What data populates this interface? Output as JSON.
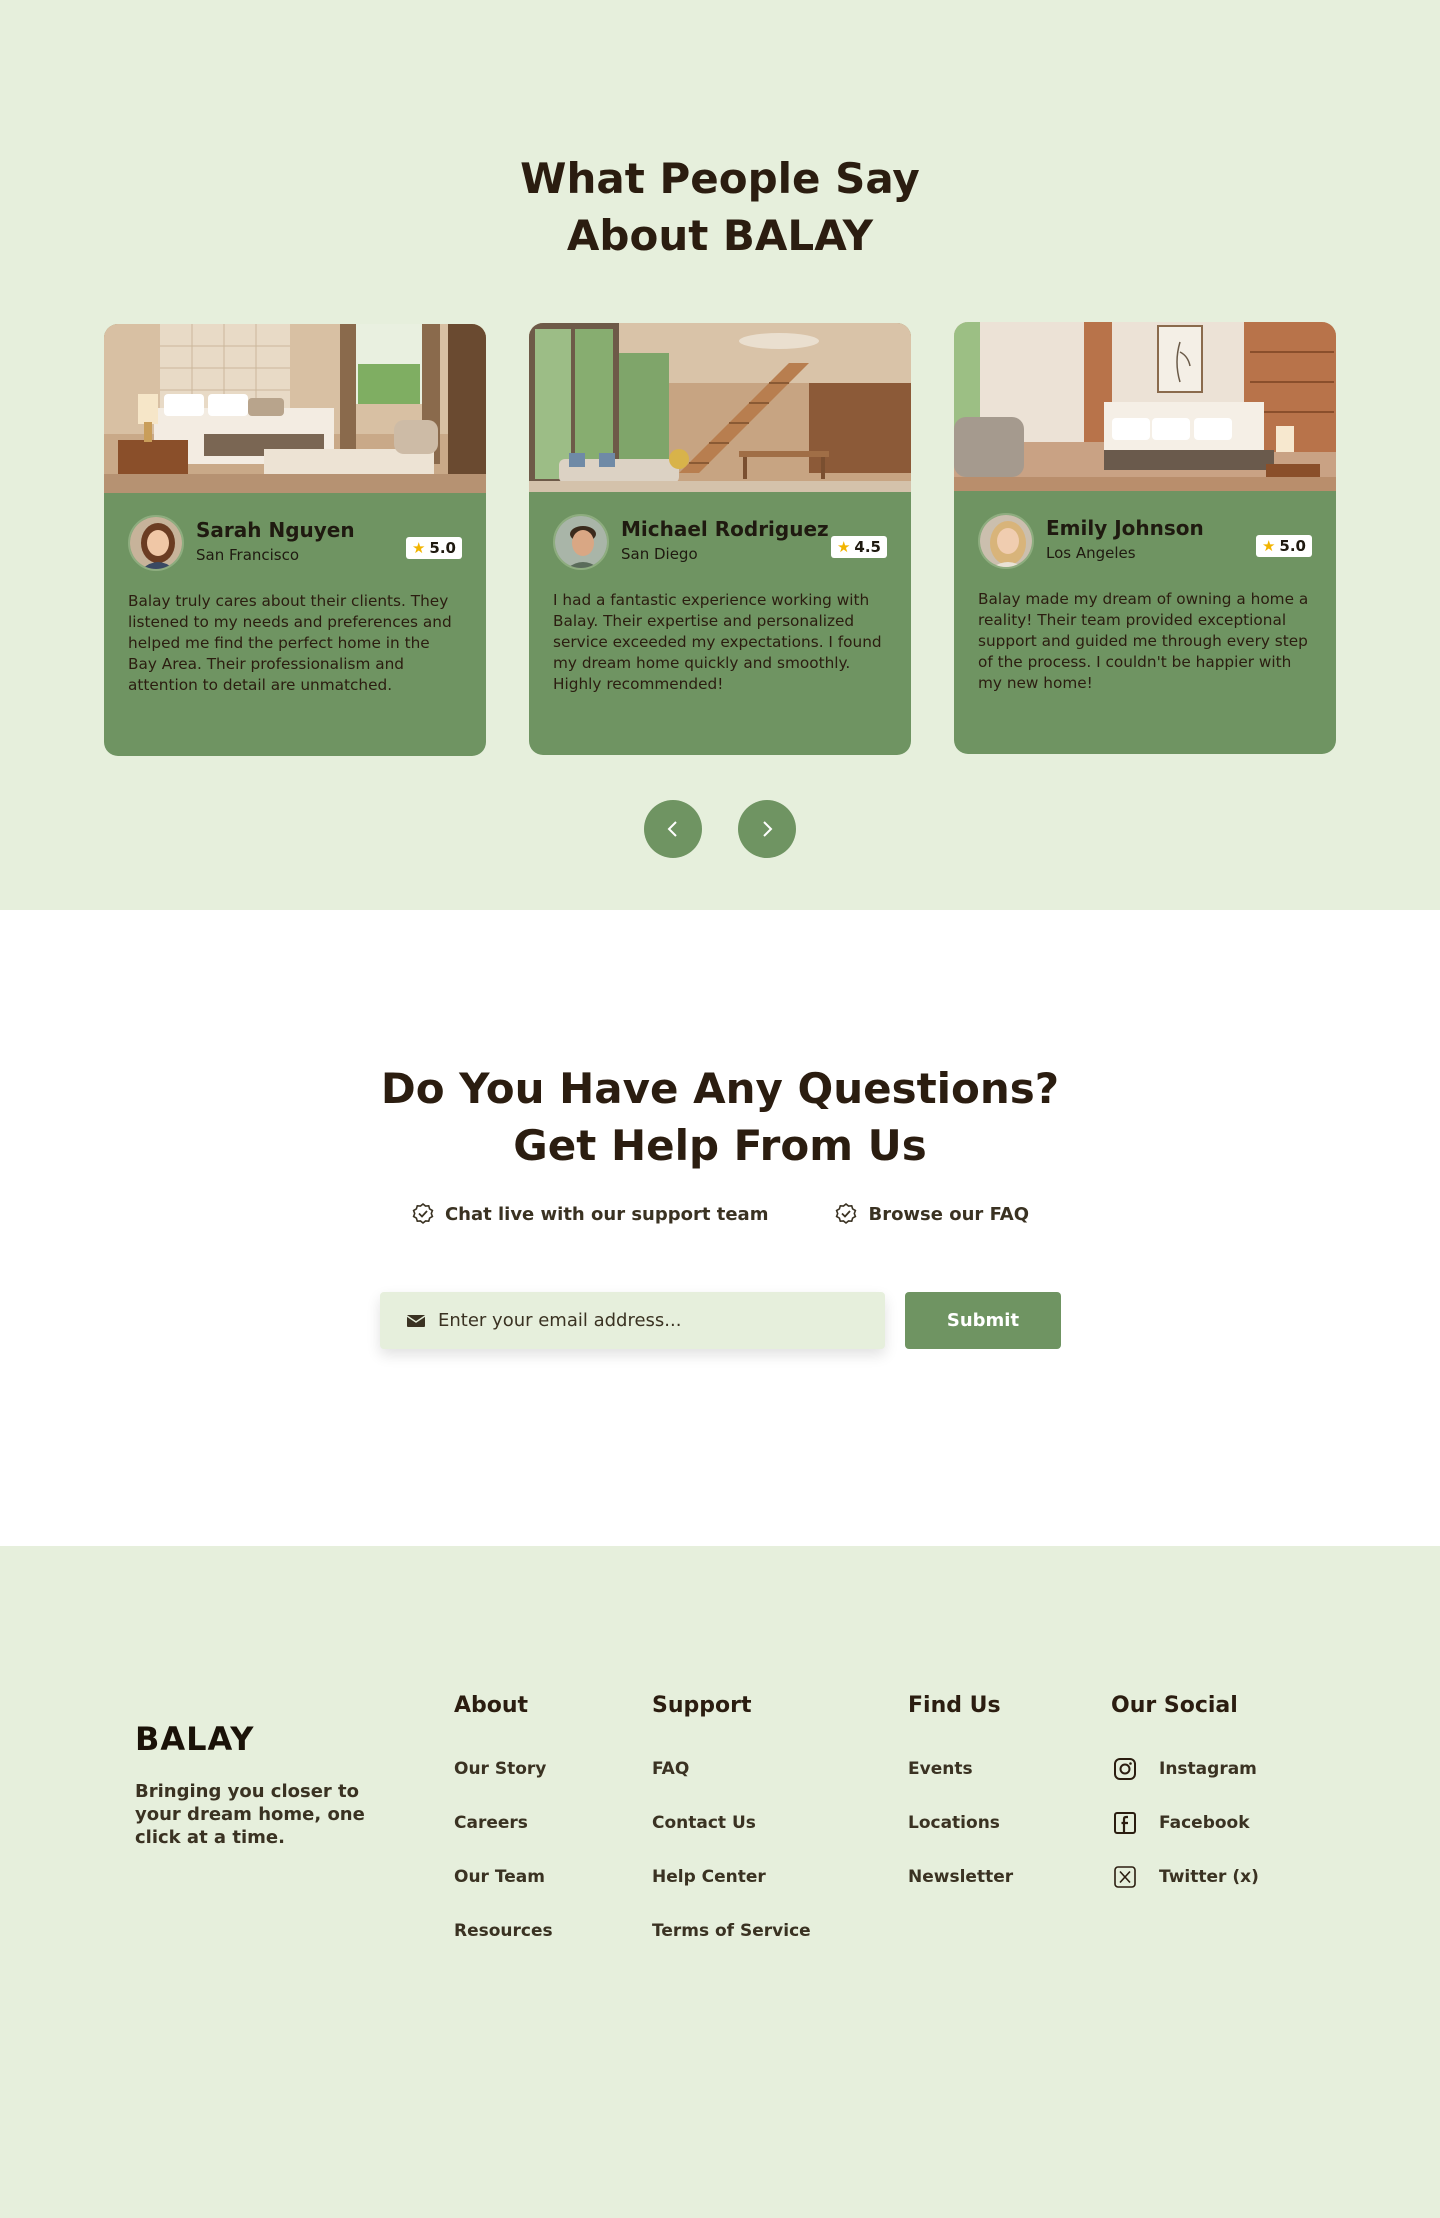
{
  "testimonials": {
    "title_line1": "What People Say",
    "title_line2": "About BALAY",
    "items": [
      {
        "name": "Sarah Nguyen",
        "city": "San Francisco",
        "rating": "5.0",
        "review": "Balay truly cares about their clients. They listened to my needs and preferences and helped me find the perfect home in the Bay Area. Their professionalism and attention to detail are unmatched."
      },
      {
        "name": "Michael Rodriguez",
        "city": "San Diego",
        "rating": "4.5",
        "review": "I had a fantastic experience working with Balay. Their expertise and personalized service exceeded my expectations. I found my dream home quickly and smoothly. Highly recommended!"
      },
      {
        "name": "Emily Johnson",
        "city": "Los Angeles",
        "rating": "5.0",
        "review": "Balay made my dream of owning a home a reality! Their team provided exceptional support and guided me through every step of the process. I couldn't be happier with my new home!"
      }
    ]
  },
  "questions": {
    "title_line1": "Do You Have Any Questions?",
    "title_line2": "Get Help From Us",
    "check1": "Chat live with our support team",
    "check2": "Browse our FAQ",
    "email_placeholder": "Enter your email address...",
    "submit_label": "Submit"
  },
  "footer": {
    "brand": "BALAY",
    "tagline": "Bringing you closer to your dream home, one click at a time.",
    "about": {
      "heading": "About",
      "links": [
        "Our Story",
        "Careers",
        "Our Team",
        "Resources"
      ]
    },
    "support": {
      "heading": "Support",
      "links": [
        "FAQ",
        "Contact Us",
        "Help Center",
        "Terms of Service"
      ]
    },
    "find": {
      "heading": "Find Us",
      "links": [
        "Events",
        "Locations",
        "Newsletter"
      ]
    },
    "social": {
      "heading": "Our Social",
      "links": [
        "Instagram",
        "Facebook",
        "Twitter (x)"
      ]
    }
  },
  "colors": {
    "bg_light": "#e6efdc",
    "accent": "#6f9462",
    "text_dark": "#2b1d10",
    "star": "#f2b400"
  },
  "icons": {
    "check": "check-badge-icon",
    "email": "envelope-icon",
    "prev": "chevron-left-icon",
    "next": "chevron-right-icon",
    "instagram": "instagram-icon",
    "facebook": "facebook-icon",
    "twitter": "x-twitter-icon"
  }
}
